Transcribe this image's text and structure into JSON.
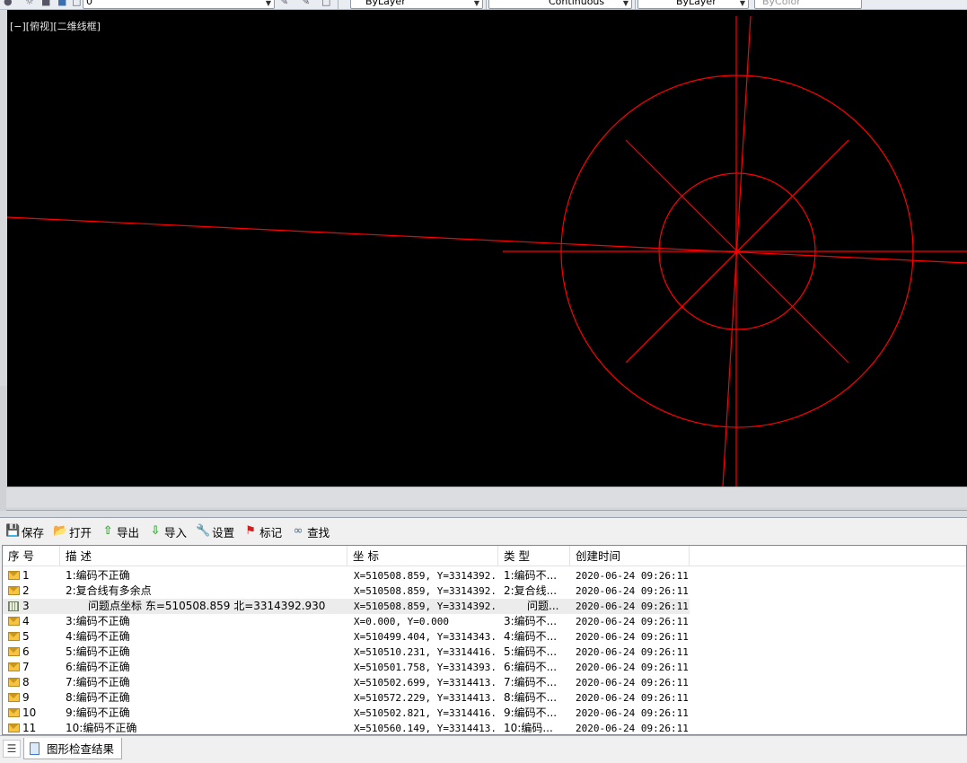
{
  "topbar": {
    "layer_combo": "0",
    "color_combo": "ByLayer",
    "linetype_combo": "Continuous",
    "lineweight_combo": "ByLayer",
    "plotstyle_combo": "ByColor"
  },
  "viewport": {
    "label": "[−][俯视][二维线框]",
    "line_color": "#ff0000"
  },
  "results_toolbar": {
    "save": "保存",
    "open": "打开",
    "export": "导出",
    "import": "导入",
    "settings": "设置",
    "mark": "标记",
    "find": "查找"
  },
  "table": {
    "headers": [
      "序 号",
      "描 述",
      "坐 标",
      "类 型",
      "创建时间"
    ],
    "rows": [
      {
        "no": "1",
        "desc": "1:编码不正确",
        "coord": "X=510508.859, Y=3314392...",
        "type": "1:编码不...",
        "time": "2020-06-24 09:26:11",
        "icon": "envelope"
      },
      {
        "no": "2",
        "desc": "2:复合线有多余点",
        "coord": "X=510508.859, Y=3314392...",
        "type": "2:复合线...",
        "time": "2020-06-24 09:26:11",
        "icon": "envelope"
      },
      {
        "no": "3",
        "desc": "问题点坐标 东=510508.859 北=3314392.930",
        "coord": "X=510508.859, Y=3314392...",
        "type": "问题...",
        "time": "2020-06-24 09:26:11",
        "icon": "grid",
        "child": true
      },
      {
        "no": "4",
        "desc": "3:编码不正确",
        "coord": "X=0.000, Y=0.000",
        "type": "3:编码不...",
        "time": "2020-06-24 09:26:11",
        "icon": "envelope"
      },
      {
        "no": "5",
        "desc": "4:编码不正确",
        "coord": "X=510499.404, Y=3314343...",
        "type": "4:编码不...",
        "time": "2020-06-24 09:26:11",
        "icon": "envelope"
      },
      {
        "no": "6",
        "desc": "5:编码不正确",
        "coord": "X=510510.231, Y=3314416...",
        "type": "5:编码不...",
        "time": "2020-06-24 09:26:11",
        "icon": "envelope"
      },
      {
        "no": "7",
        "desc": "6:编码不正确",
        "coord": "X=510501.758, Y=3314393...",
        "type": "6:编码不...",
        "time": "2020-06-24 09:26:11",
        "icon": "envelope"
      },
      {
        "no": "8",
        "desc": "7:编码不正确",
        "coord": "X=510502.699, Y=3314413...",
        "type": "7:编码不...",
        "time": "2020-06-24 09:26:11",
        "icon": "envelope"
      },
      {
        "no": "9",
        "desc": "8:编码不正确",
        "coord": "X=510572.229, Y=3314413...",
        "type": "8:编码不...",
        "time": "2020-06-24 09:26:11",
        "icon": "envelope"
      },
      {
        "no": "10",
        "desc": "9:编码不正确",
        "coord": "X=510502.821, Y=3314416...",
        "type": "9:编码不...",
        "time": "2020-06-24 09:26:11",
        "icon": "envelope"
      },
      {
        "no": "11",
        "desc": "10:编码不正确",
        "coord": "X=510560.149, Y=3314413...",
        "type": "10:编码...",
        "time": "2020-06-24 09:26:11",
        "icon": "envelope"
      }
    ]
  },
  "bottom_tabs": {
    "active": "图形检查结果"
  }
}
